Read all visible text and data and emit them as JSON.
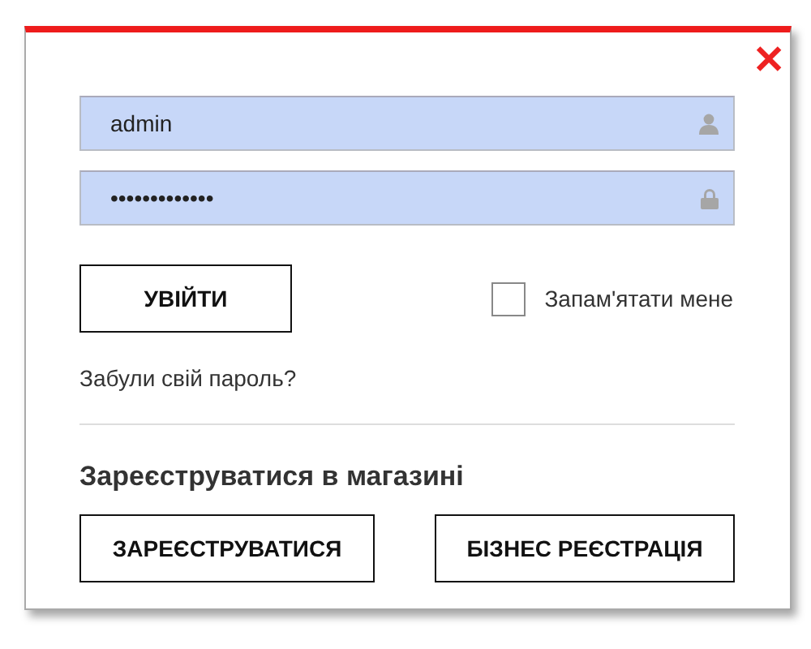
{
  "dialog": {
    "close": "✕",
    "fields": [
      {
        "kind": "user",
        "value": "admin"
      },
      {
        "kind": "password",
        "value": "•••••••••••••"
      }
    ],
    "login_button": "УВІЙТИ",
    "remember": {
      "label": "Запам'ятати мене",
      "checked": false
    },
    "forgot_link": "Забули свій пароль?",
    "register_heading": "Зареєструватися в магазині",
    "register_buttons": [
      "ЗАРЕЄСТРУВАТИСЯ",
      "БІЗНЕС РЕЄСТРАЦІЯ"
    ]
  }
}
